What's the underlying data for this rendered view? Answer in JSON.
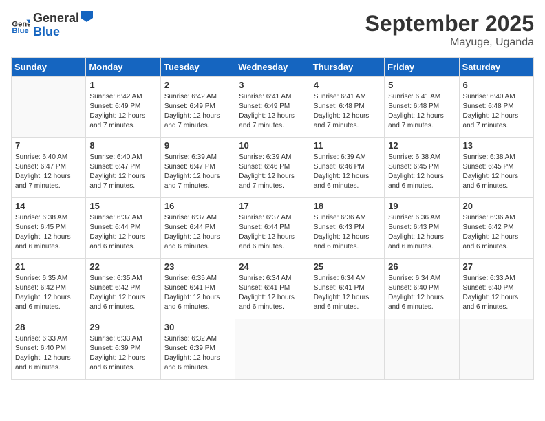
{
  "header": {
    "logo_general": "General",
    "logo_blue": "Blue",
    "month": "September 2025",
    "location": "Mayuge, Uganda"
  },
  "days_of_week": [
    "Sunday",
    "Monday",
    "Tuesday",
    "Wednesday",
    "Thursday",
    "Friday",
    "Saturday"
  ],
  "weeks": [
    [
      {
        "day": "",
        "info": ""
      },
      {
        "day": "1",
        "info": "Sunrise: 6:42 AM\nSunset: 6:49 PM\nDaylight: 12 hours\nand 7 minutes."
      },
      {
        "day": "2",
        "info": "Sunrise: 6:42 AM\nSunset: 6:49 PM\nDaylight: 12 hours\nand 7 minutes."
      },
      {
        "day": "3",
        "info": "Sunrise: 6:41 AM\nSunset: 6:49 PM\nDaylight: 12 hours\nand 7 minutes."
      },
      {
        "day": "4",
        "info": "Sunrise: 6:41 AM\nSunset: 6:48 PM\nDaylight: 12 hours\nand 7 minutes."
      },
      {
        "day": "5",
        "info": "Sunrise: 6:41 AM\nSunset: 6:48 PM\nDaylight: 12 hours\nand 7 minutes."
      },
      {
        "day": "6",
        "info": "Sunrise: 6:40 AM\nSunset: 6:48 PM\nDaylight: 12 hours\nand 7 minutes."
      }
    ],
    [
      {
        "day": "7",
        "info": "Sunrise: 6:40 AM\nSunset: 6:47 PM\nDaylight: 12 hours\nand 7 minutes."
      },
      {
        "day": "8",
        "info": "Sunrise: 6:40 AM\nSunset: 6:47 PM\nDaylight: 12 hours\nand 7 minutes."
      },
      {
        "day": "9",
        "info": "Sunrise: 6:39 AM\nSunset: 6:47 PM\nDaylight: 12 hours\nand 7 minutes."
      },
      {
        "day": "10",
        "info": "Sunrise: 6:39 AM\nSunset: 6:46 PM\nDaylight: 12 hours\nand 7 minutes."
      },
      {
        "day": "11",
        "info": "Sunrise: 6:39 AM\nSunset: 6:46 PM\nDaylight: 12 hours\nand 6 minutes."
      },
      {
        "day": "12",
        "info": "Sunrise: 6:38 AM\nSunset: 6:45 PM\nDaylight: 12 hours\nand 6 minutes."
      },
      {
        "day": "13",
        "info": "Sunrise: 6:38 AM\nSunset: 6:45 PM\nDaylight: 12 hours\nand 6 minutes."
      }
    ],
    [
      {
        "day": "14",
        "info": "Sunrise: 6:38 AM\nSunset: 6:45 PM\nDaylight: 12 hours\nand 6 minutes."
      },
      {
        "day": "15",
        "info": "Sunrise: 6:37 AM\nSunset: 6:44 PM\nDaylight: 12 hours\nand 6 minutes."
      },
      {
        "day": "16",
        "info": "Sunrise: 6:37 AM\nSunset: 6:44 PM\nDaylight: 12 hours\nand 6 minutes."
      },
      {
        "day": "17",
        "info": "Sunrise: 6:37 AM\nSunset: 6:44 PM\nDaylight: 12 hours\nand 6 minutes."
      },
      {
        "day": "18",
        "info": "Sunrise: 6:36 AM\nSunset: 6:43 PM\nDaylight: 12 hours\nand 6 minutes."
      },
      {
        "day": "19",
        "info": "Sunrise: 6:36 AM\nSunset: 6:43 PM\nDaylight: 12 hours\nand 6 minutes."
      },
      {
        "day": "20",
        "info": "Sunrise: 6:36 AM\nSunset: 6:42 PM\nDaylight: 12 hours\nand 6 minutes."
      }
    ],
    [
      {
        "day": "21",
        "info": "Sunrise: 6:35 AM\nSunset: 6:42 PM\nDaylight: 12 hours\nand 6 minutes."
      },
      {
        "day": "22",
        "info": "Sunrise: 6:35 AM\nSunset: 6:42 PM\nDaylight: 12 hours\nand 6 minutes."
      },
      {
        "day": "23",
        "info": "Sunrise: 6:35 AM\nSunset: 6:41 PM\nDaylight: 12 hours\nand 6 minutes."
      },
      {
        "day": "24",
        "info": "Sunrise: 6:34 AM\nSunset: 6:41 PM\nDaylight: 12 hours\nand 6 minutes."
      },
      {
        "day": "25",
        "info": "Sunrise: 6:34 AM\nSunset: 6:41 PM\nDaylight: 12 hours\nand 6 minutes."
      },
      {
        "day": "26",
        "info": "Sunrise: 6:34 AM\nSunset: 6:40 PM\nDaylight: 12 hours\nand 6 minutes."
      },
      {
        "day": "27",
        "info": "Sunrise: 6:33 AM\nSunset: 6:40 PM\nDaylight: 12 hours\nand 6 minutes."
      }
    ],
    [
      {
        "day": "28",
        "info": "Sunrise: 6:33 AM\nSunset: 6:40 PM\nDaylight: 12 hours\nand 6 minutes."
      },
      {
        "day": "29",
        "info": "Sunrise: 6:33 AM\nSunset: 6:39 PM\nDaylight: 12 hours\nand 6 minutes."
      },
      {
        "day": "30",
        "info": "Sunrise: 6:32 AM\nSunset: 6:39 PM\nDaylight: 12 hours\nand 6 minutes."
      },
      {
        "day": "",
        "info": ""
      },
      {
        "day": "",
        "info": ""
      },
      {
        "day": "",
        "info": ""
      },
      {
        "day": "",
        "info": ""
      }
    ]
  ]
}
